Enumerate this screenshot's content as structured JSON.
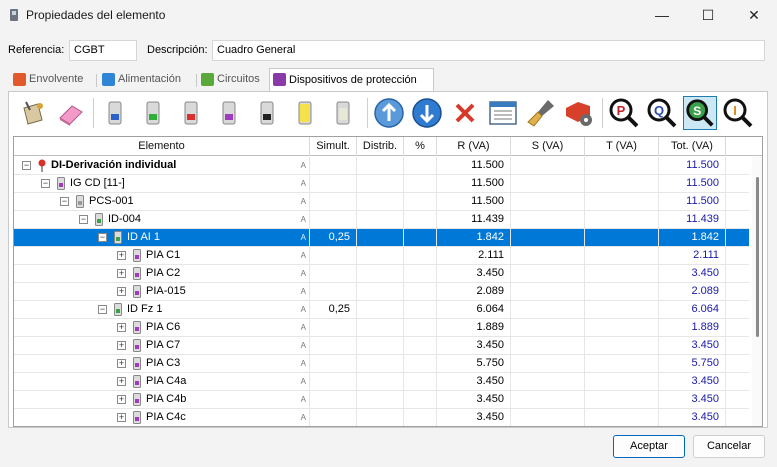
{
  "window": {
    "title": "Propiedades del elemento",
    "minimize_label": "—",
    "maximize_label": "☐",
    "close_label": "✕"
  },
  "form": {
    "referencia_label": "Referencia:",
    "referencia_value": "CGBT",
    "descripcion_label": "Descripción:",
    "descripcion_value": "Cuadro General"
  },
  "tabs": [
    {
      "label": "Envolvente",
      "icon": "envelope-box-icon",
      "color": "#e25a2c"
    },
    {
      "label": "Alimentación",
      "icon": "power-supply-icon",
      "color": "#2f86d6"
    },
    {
      "label": "Circuitos",
      "icon": "circuits-icon",
      "color": "#5aa83a"
    },
    {
      "label": "Dispositivos de protección",
      "icon": "protection-devices-icon",
      "color": "#8a3aa8"
    }
  ],
  "toolbar": {
    "icons": [
      "paint-bucket-icon",
      "eraser-icon",
      "device-blue-icon",
      "device-green-icon",
      "device-red-icon",
      "device-purple-icon",
      "device-black-icon",
      "device-yellow-icon",
      "device-grey-icon",
      "move-up-icon",
      "move-down-icon",
      "delete-icon",
      "table-view-icon",
      "brush-icon",
      "tag-settings-icon",
      "zoom-p-icon",
      "zoom-q-icon",
      "zoom-s-icon",
      "zoom-i-icon"
    ],
    "zoom_letters": [
      "P",
      "Q",
      "S",
      "I"
    ]
  },
  "grid": {
    "headers": [
      "Elemento",
      "Simult.",
      "Distrib.",
      "%",
      "R (VA)",
      "S (VA)",
      "T (VA)",
      "Tot. (VA)"
    ],
    "a_mark": "A",
    "rows": [
      {
        "name": "DI-Derivación individual",
        "simult": "",
        "r": "11.500",
        "tot": "11.500",
        "level": 0,
        "icon": "pin",
        "bold": true,
        "selected": false
      },
      {
        "name": "IG CD [11-]",
        "simult": "",
        "r": "11.500",
        "tot": "11.500",
        "level": 1,
        "icon": "purple",
        "bold": false,
        "selected": false
      },
      {
        "name": "PCS-001",
        "simult": "",
        "r": "11.500",
        "tot": "11.500",
        "level": 2,
        "icon": "grey",
        "bold": false,
        "selected": false
      },
      {
        "name": "ID-004",
        "simult": "",
        "r": "11.439",
        "tot": "11.439",
        "level": 3,
        "icon": "green",
        "bold": false,
        "selected": false
      },
      {
        "name": "ID AI 1",
        "simult": "0,25",
        "r": "1.842",
        "tot": "1.842",
        "level": 4,
        "icon": "green",
        "bold": false,
        "selected": true
      },
      {
        "name": "PIA C1",
        "simult": "",
        "r": "2.111",
        "tot": "2.111",
        "level": 5,
        "icon": "purple",
        "bold": false,
        "selected": false
      },
      {
        "name": "PIA C2",
        "simult": "",
        "r": "3.450",
        "tot": "3.450",
        "level": 5,
        "icon": "purple",
        "bold": false,
        "selected": false
      },
      {
        "name": "PIA-015",
        "simult": "",
        "r": "2.089",
        "tot": "2.089",
        "level": 5,
        "icon": "purple",
        "bold": false,
        "selected": false
      },
      {
        "name": "ID Fz 1",
        "simult": "0,25",
        "r": "6.064",
        "tot": "6.064",
        "level": 4,
        "icon": "green",
        "bold": false,
        "selected": false
      },
      {
        "name": "PIA C6",
        "simult": "",
        "r": "1.889",
        "tot": "1.889",
        "level": 5,
        "icon": "purple",
        "bold": false,
        "selected": false
      },
      {
        "name": "PIA C7",
        "simult": "",
        "r": "3.450",
        "tot": "3.450",
        "level": 5,
        "icon": "purple",
        "bold": false,
        "selected": false
      },
      {
        "name": "PIA C3",
        "simult": "",
        "r": "5.750",
        "tot": "5.750",
        "level": 5,
        "icon": "purple",
        "bold": false,
        "selected": false
      },
      {
        "name": "PIA C4a",
        "simult": "",
        "r": "3.450",
        "tot": "3.450",
        "level": 5,
        "icon": "purple",
        "bold": false,
        "selected": false
      },
      {
        "name": "PIA C4b",
        "simult": "",
        "r": "3.450",
        "tot": "3.450",
        "level": 5,
        "icon": "purple",
        "bold": false,
        "selected": false
      },
      {
        "name": "PIA C4c",
        "simult": "",
        "r": "3.450",
        "tot": "3.450",
        "level": 5,
        "icon": "purple",
        "bold": false,
        "selected": false
      }
    ]
  },
  "buttons": {
    "accept": "Aceptar",
    "cancel": "Cancelar"
  }
}
